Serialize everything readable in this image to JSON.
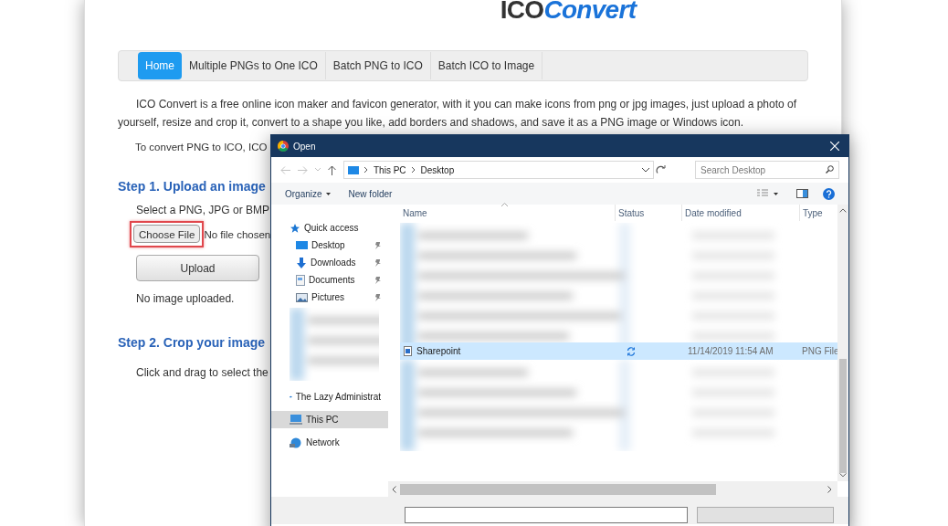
{
  "logo": {
    "part_1": "ICO",
    "part_2": "Convert"
  },
  "nav": [
    {
      "label": "Home",
      "selected": true
    },
    {
      "label": "Multiple PNGs to One ICO",
      "selected": false
    },
    {
      "label": "Batch PNG to ICO",
      "selected": false
    },
    {
      "label": "Batch ICO to Image",
      "selected": false
    }
  ],
  "intro": "ICO Convert is a free online icon maker and favicon generator, with it you can make icons from png or jpg images, just upload a photo of yourself, resize and crop it, convert to a shape you like, add borders and shadows, and save it as a PNG image or Windows icon.",
  "intro_2": "To convert PNG to ICO, ICO",
  "step_1": {
    "heading": "Step 1. Upload an image",
    "text": "Select a PNG, JPG or BMP",
    "choose_button": "Choose File",
    "file_status": "No file chosen",
    "upload_button": "Upload",
    "result": "No image uploaded."
  },
  "step_2": {
    "heading": "Step 2. Crop your image",
    "text": "Click and drag to select the"
  },
  "dialog": {
    "title": "Open",
    "breadcrumb": [
      "This PC",
      "Desktop"
    ],
    "search": {
      "placeholder": "Search Desktop"
    },
    "toolbar": [
      "Organize",
      "New folder"
    ],
    "sidebar": [
      {
        "kind": "group",
        "label": "Quick access",
        "selected": false
      },
      {
        "kind": "pinned",
        "label": "Desktop",
        "selected": false
      },
      {
        "kind": "pinned",
        "label": "Downloads",
        "selected": false
      },
      {
        "kind": "pinned",
        "label": "Documents",
        "selected": false
      },
      {
        "kind": "pinned",
        "label": "Pictures",
        "selected": false
      },
      {
        "kind": "blurred"
      },
      {
        "kind": "group",
        "label": "The Lazy Administrat",
        "selected": false
      },
      {
        "kind": "group",
        "label": "This PC",
        "selected": true
      },
      {
        "kind": "group",
        "label": "Network",
        "selected": false
      }
    ],
    "columns": [
      "Name",
      "Status",
      "Date modified",
      "Type"
    ],
    "files": [
      {
        "kind": "blurred"
      },
      {
        "kind": "file",
        "name": "Sharepoint",
        "date": "11/14/2019 11:54 AM",
        "type": "PNG File",
        "selected": true
      },
      {
        "kind": "blurred"
      }
    ]
  }
}
